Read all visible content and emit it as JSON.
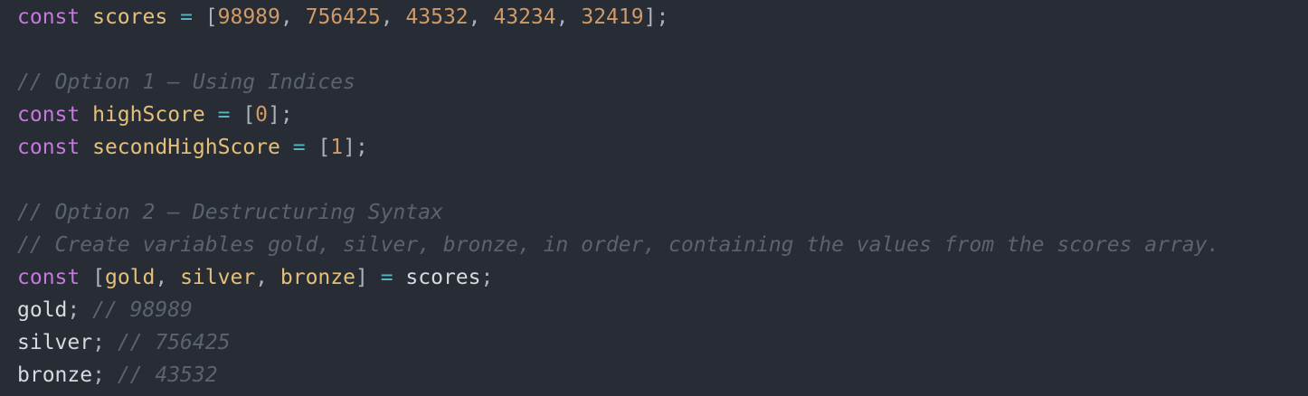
{
  "colors": {
    "background": "#282c34",
    "keyword": "#c678dd",
    "variable": "#e5c07b",
    "number": "#d19a66",
    "operator": "#56b6c2",
    "punctuation": "#abb2bf",
    "plain": "#d7dae0",
    "comment": "#5c6370"
  },
  "code": {
    "line1": {
      "kw": "const",
      "name": "scores",
      "eq": "=",
      "open": "[",
      "n1": "98989",
      "c1": ",",
      "n2": "756425",
      "c2": ",",
      "n3": "43532",
      "c3": ",",
      "n4": "43234",
      "c4": ",",
      "n5": "32419",
      "close": "];"
    },
    "comment_option1": "// Option 1 – Using Indices",
    "line_high": {
      "kw": "const",
      "name": "highScore",
      "eq": "=",
      "open": "[",
      "idx": "0",
      "close": "];"
    },
    "line_second": {
      "kw": "const",
      "name": "secondHighScore",
      "eq": "=",
      "open": "[",
      "idx": "1",
      "close": "];"
    },
    "comment_option2": "// Option 2 – Destructuring Syntax",
    "comment_create": "// Create variables gold, silver, bronze, in order, containing the values from the scores array.",
    "line_destructure": {
      "kw": "const",
      "open": "[",
      "v1": "gold",
      "c1": ",",
      "v2": "silver",
      "c2": ",",
      "v3": "bronze",
      "close": "]",
      "eq": "=",
      "src": "scores",
      "semi": ";"
    },
    "line_gold": {
      "name": "gold",
      "semi": ";",
      "comment": "// 98989"
    },
    "line_silver": {
      "name": "silver",
      "semi": ";",
      "comment": "// 756425"
    },
    "line_bronze": {
      "name": "bronze",
      "semi": ";",
      "comment": "// 43532"
    }
  }
}
